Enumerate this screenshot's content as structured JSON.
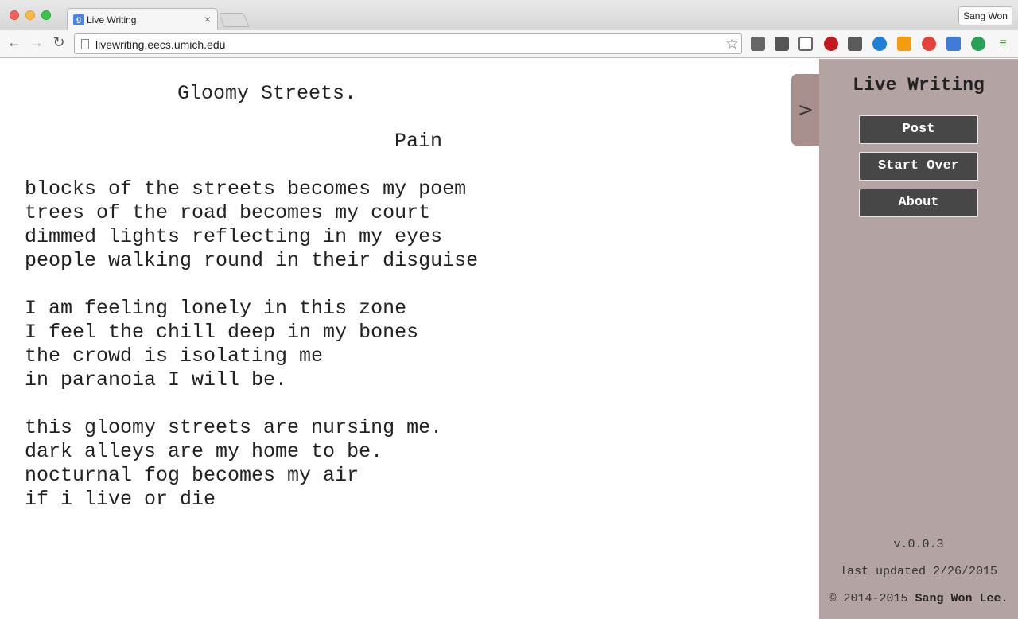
{
  "browser": {
    "tab_title": "Live Writing",
    "favicon_letter": "g",
    "tab_close": "×",
    "profile_name": "Sang Won",
    "url": "livewriting.eecs.umich.edu",
    "back_icon": "←",
    "forward_icon": "→",
    "reload_icon": "↻",
    "star_icon": "☆"
  },
  "editor": {
    "title": "Gloomy Streets.",
    "subtitle": "Pain",
    "lines": [
      "blocks of the streets becomes my poem",
      "trees of the road becomes my court",
      "dimmed lights reflecting in my eyes",
      "people walking round in their disguise",
      "I am feeling lonely in this zone",
      "I feel the chill deep in my bones",
      "the crowd is isolating me",
      "in paranoia I will be.",
      "this gloomy streets are nursing me.",
      "dark alleys are my home to be.",
      "nocturnal fog becomes my air",
      "if i live or die"
    ]
  },
  "sidebar": {
    "toggle_label": ">",
    "title": "Live Writing",
    "buttons": {
      "post": "Post",
      "start_over": "Start Over",
      "about": "About"
    },
    "version": "v.0.0.3",
    "last_updated": "last updated 2/26/2015",
    "copyright_prefix": "© 2014-2015 ",
    "copyright_name": "Sang Won Lee."
  }
}
